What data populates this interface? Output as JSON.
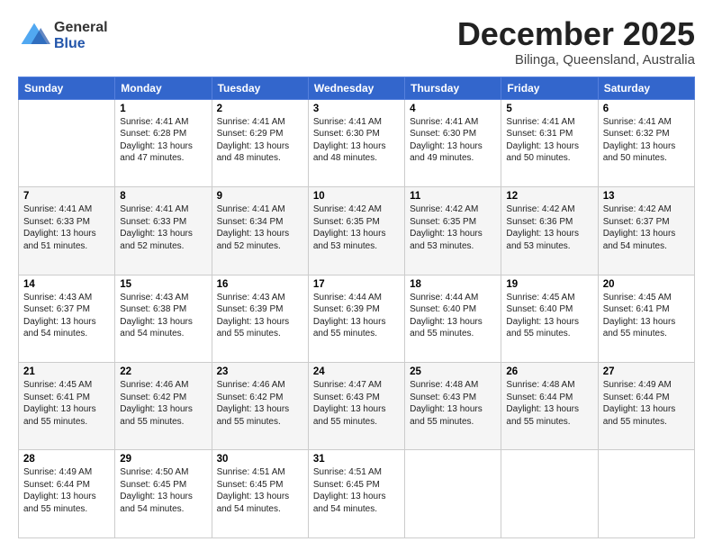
{
  "logo": {
    "general": "General",
    "blue": "Blue"
  },
  "title": "December 2025",
  "location": "Bilinga, Queensland, Australia",
  "days_of_week": [
    "Sunday",
    "Monday",
    "Tuesday",
    "Wednesday",
    "Thursday",
    "Friday",
    "Saturday"
  ],
  "weeks": [
    [
      {
        "day": "",
        "content": ""
      },
      {
        "day": "1",
        "content": "Sunrise: 4:41 AM\nSunset: 6:28 PM\nDaylight: 13 hours\nand 47 minutes."
      },
      {
        "day": "2",
        "content": "Sunrise: 4:41 AM\nSunset: 6:29 PM\nDaylight: 13 hours\nand 48 minutes."
      },
      {
        "day": "3",
        "content": "Sunrise: 4:41 AM\nSunset: 6:30 PM\nDaylight: 13 hours\nand 48 minutes."
      },
      {
        "day": "4",
        "content": "Sunrise: 4:41 AM\nSunset: 6:30 PM\nDaylight: 13 hours\nand 49 minutes."
      },
      {
        "day": "5",
        "content": "Sunrise: 4:41 AM\nSunset: 6:31 PM\nDaylight: 13 hours\nand 50 minutes."
      },
      {
        "day": "6",
        "content": "Sunrise: 4:41 AM\nSunset: 6:32 PM\nDaylight: 13 hours\nand 50 minutes."
      }
    ],
    [
      {
        "day": "7",
        "content": "Sunrise: 4:41 AM\nSunset: 6:33 PM\nDaylight: 13 hours\nand 51 minutes."
      },
      {
        "day": "8",
        "content": "Sunrise: 4:41 AM\nSunset: 6:33 PM\nDaylight: 13 hours\nand 52 minutes."
      },
      {
        "day": "9",
        "content": "Sunrise: 4:41 AM\nSunset: 6:34 PM\nDaylight: 13 hours\nand 52 minutes."
      },
      {
        "day": "10",
        "content": "Sunrise: 4:42 AM\nSunset: 6:35 PM\nDaylight: 13 hours\nand 53 minutes."
      },
      {
        "day": "11",
        "content": "Sunrise: 4:42 AM\nSunset: 6:35 PM\nDaylight: 13 hours\nand 53 minutes."
      },
      {
        "day": "12",
        "content": "Sunrise: 4:42 AM\nSunset: 6:36 PM\nDaylight: 13 hours\nand 53 minutes."
      },
      {
        "day": "13",
        "content": "Sunrise: 4:42 AM\nSunset: 6:37 PM\nDaylight: 13 hours\nand 54 minutes."
      }
    ],
    [
      {
        "day": "14",
        "content": "Sunrise: 4:43 AM\nSunset: 6:37 PM\nDaylight: 13 hours\nand 54 minutes."
      },
      {
        "day": "15",
        "content": "Sunrise: 4:43 AM\nSunset: 6:38 PM\nDaylight: 13 hours\nand 54 minutes."
      },
      {
        "day": "16",
        "content": "Sunrise: 4:43 AM\nSunset: 6:39 PM\nDaylight: 13 hours\nand 55 minutes."
      },
      {
        "day": "17",
        "content": "Sunrise: 4:44 AM\nSunset: 6:39 PM\nDaylight: 13 hours\nand 55 minutes."
      },
      {
        "day": "18",
        "content": "Sunrise: 4:44 AM\nSunset: 6:40 PM\nDaylight: 13 hours\nand 55 minutes."
      },
      {
        "day": "19",
        "content": "Sunrise: 4:45 AM\nSunset: 6:40 PM\nDaylight: 13 hours\nand 55 minutes."
      },
      {
        "day": "20",
        "content": "Sunrise: 4:45 AM\nSunset: 6:41 PM\nDaylight: 13 hours\nand 55 minutes."
      }
    ],
    [
      {
        "day": "21",
        "content": "Sunrise: 4:45 AM\nSunset: 6:41 PM\nDaylight: 13 hours\nand 55 minutes."
      },
      {
        "day": "22",
        "content": "Sunrise: 4:46 AM\nSunset: 6:42 PM\nDaylight: 13 hours\nand 55 minutes."
      },
      {
        "day": "23",
        "content": "Sunrise: 4:46 AM\nSunset: 6:42 PM\nDaylight: 13 hours\nand 55 minutes."
      },
      {
        "day": "24",
        "content": "Sunrise: 4:47 AM\nSunset: 6:43 PM\nDaylight: 13 hours\nand 55 minutes."
      },
      {
        "day": "25",
        "content": "Sunrise: 4:48 AM\nSunset: 6:43 PM\nDaylight: 13 hours\nand 55 minutes."
      },
      {
        "day": "26",
        "content": "Sunrise: 4:48 AM\nSunset: 6:44 PM\nDaylight: 13 hours\nand 55 minutes."
      },
      {
        "day": "27",
        "content": "Sunrise: 4:49 AM\nSunset: 6:44 PM\nDaylight: 13 hours\nand 55 minutes."
      }
    ],
    [
      {
        "day": "28",
        "content": "Sunrise: 4:49 AM\nSunset: 6:44 PM\nDaylight: 13 hours\nand 55 minutes."
      },
      {
        "day": "29",
        "content": "Sunrise: 4:50 AM\nSunset: 6:45 PM\nDaylight: 13 hours\nand 54 minutes."
      },
      {
        "day": "30",
        "content": "Sunrise: 4:51 AM\nSunset: 6:45 PM\nDaylight: 13 hours\nand 54 minutes."
      },
      {
        "day": "31",
        "content": "Sunrise: 4:51 AM\nSunset: 6:45 PM\nDaylight: 13 hours\nand 54 minutes."
      },
      {
        "day": "",
        "content": ""
      },
      {
        "day": "",
        "content": ""
      },
      {
        "day": "",
        "content": ""
      }
    ]
  ]
}
